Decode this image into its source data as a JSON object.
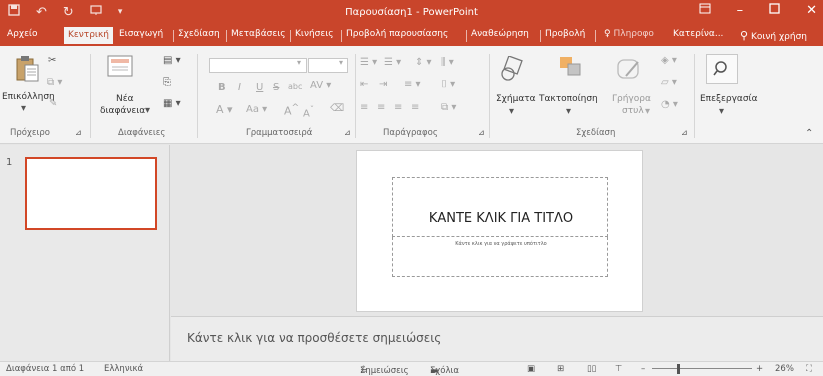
{
  "window": {
    "title": "Παρουσίαση1 - PowerPoint",
    "accent": "#c9452b"
  },
  "qat": {
    "save_icon": "save-icon",
    "undo_icon": "undo-icon",
    "redo_icon": "redo-icon",
    "present_icon": "present-icon"
  },
  "tabs": [
    "Αρχείο",
    "Κεντρική",
    "Εισαγωγή",
    "Σχεδίαση",
    "Μεταβάσεις",
    "Κινήσεις",
    "Προβολή παρουσίασης",
    "Αναθεώρηση",
    "Προβολή",
    "Πληροφο",
    "Κατερίνα...",
    "Κοινή χρήση"
  ],
  "ribbon": {
    "clipboard": {
      "paste_label": "Επικόλληση",
      "group_label": "Πρόχειρο"
    },
    "slides": {
      "new_slide_line1": "Νέα",
      "new_slide_line2": "διαφάνεια",
      "group_label": "Διαφάνειες"
    },
    "font": {
      "group_label": "Γραμματοσειρά",
      "bold": "B",
      "italic": "I",
      "underline": "U",
      "strike": "S",
      "abc": "abc",
      "spacing": "AV",
      "font_color": "A",
      "change_case": "Aa",
      "grow": "A",
      "shrink": "A"
    },
    "paragraph": {
      "group_label": "Παράγραφος"
    },
    "drawing": {
      "shapes_label": "Σχήματα",
      "arrange_label": "Τακτοποίηση",
      "quick_styles_line1": "Γρήγορα",
      "quick_styles_line2": "στυλ",
      "group_label": "Σχεδίαση"
    },
    "editing": {
      "label": "Επεξεργασία"
    }
  },
  "thumbnails": {
    "slide_number": "1"
  },
  "slide": {
    "title_placeholder": "ΚΑΝΤΕ ΚΛΙΚ ΓΙΑ ΤΙΤΛΟ",
    "subtitle_placeholder": "Κάντε κλικ για να γράψετε υπότιτλο"
  },
  "notes": {
    "placeholder": "Κάντε κλικ για να προσθέσετε σημειώσεις"
  },
  "status": {
    "slide_count": "Διαφάνεια 1 από 1",
    "language": "Ελληνικά",
    "notes_button": "Σημειώσεις",
    "comments_button": "Σχόλια",
    "zoom": "26%"
  }
}
